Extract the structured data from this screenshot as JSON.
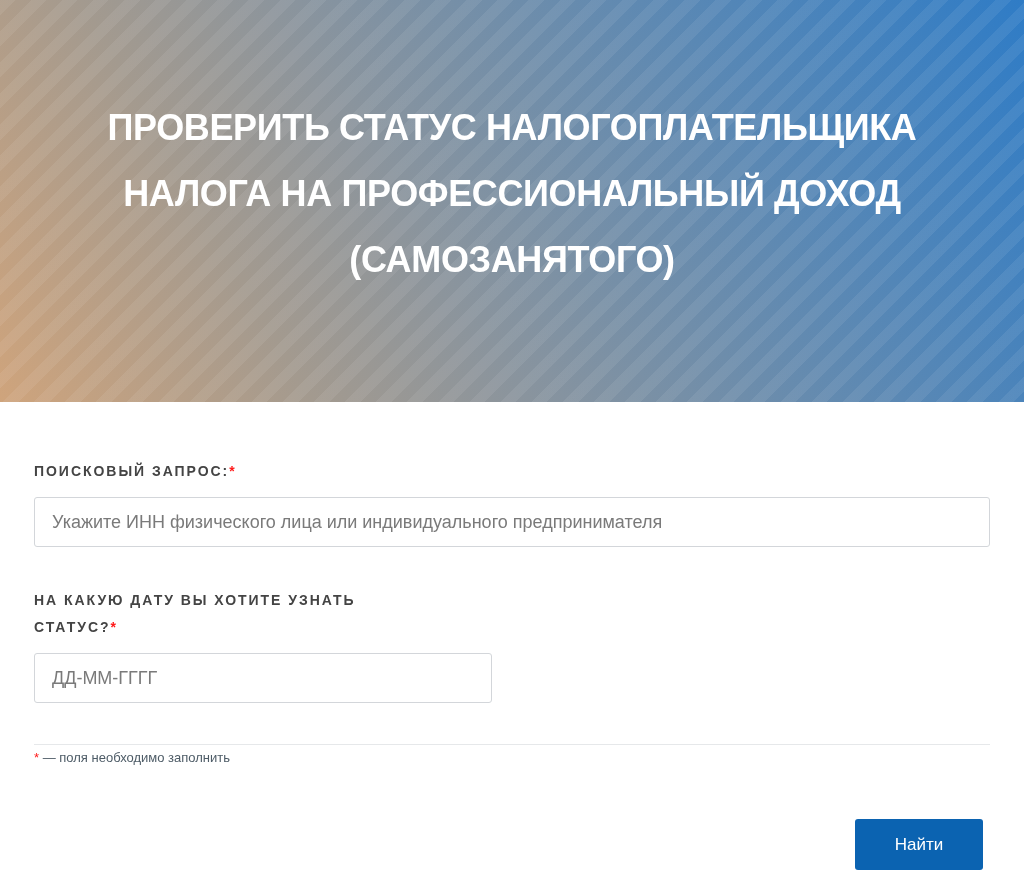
{
  "header": {
    "title": "ПРОВЕРИТЬ СТАТУС НАЛОГОПЛАТЕЛЬЩИКА НАЛОГА НА ПРОФЕССИОНАЛЬНЫЙ ДОХОД (САМОЗАНЯТОГО)"
  },
  "form": {
    "fields": [
      {
        "kind": "wide",
        "label": "ПОИСКОВЫЙ ЗАПРОС:",
        "required_mark": "*",
        "placeholder": "Укажите ИНН физического лица или индивидуального предпринимателя"
      },
      {
        "kind": "narrow",
        "label": "НА КАКУЮ ДАТУ ВЫ ХОТИТЕ УЗНАТЬ СТАТУС?",
        "required_mark": "*",
        "placeholder": "ДД-ММ-ГГГГ"
      }
    ],
    "note": {
      "mark": "*",
      "text": "— поля необходимо заполнить"
    },
    "submit_button": {
      "label": "Найти"
    }
  }
}
